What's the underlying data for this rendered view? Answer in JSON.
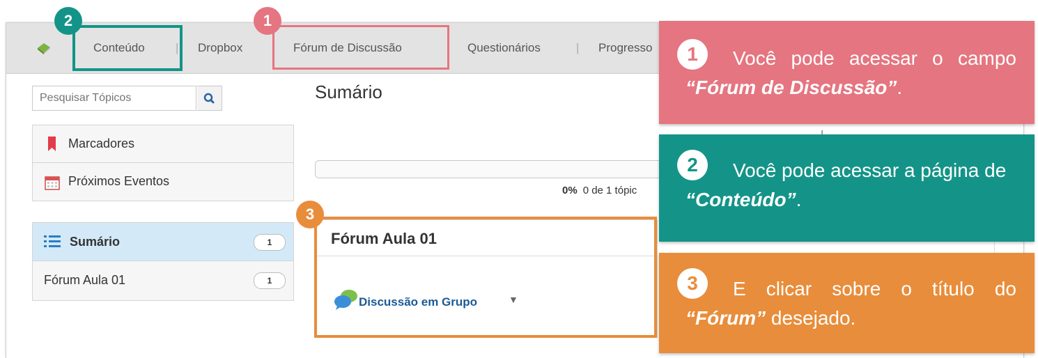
{
  "nav": {
    "items": [
      "Conteúdo",
      "Dropbox",
      "Fórum de Discussão",
      "Questionários",
      "Progresso"
    ],
    "separator": "|"
  },
  "sidebar": {
    "search_placeholder": "Pesquisar Tópicos",
    "bookmarks_label": "Marcadores",
    "events_label": "Próximos Eventos",
    "toc": [
      {
        "label": "Sumário",
        "count": "1"
      },
      {
        "label": "Fórum Aula 01",
        "count": "1"
      }
    ]
  },
  "main": {
    "title": "Sumário",
    "progress": {
      "percent_label": "0%",
      "detail": "0 de 1 tópic",
      "fraction": 0
    },
    "forum": {
      "title": "Fórum Aula 01",
      "topic": "Discussão em Grupo"
    }
  },
  "annotations": [
    {
      "number": "1",
      "color": "#e57580",
      "text_before": "Você pode acessar o campo",
      "emphasis": "“Fórum de Discussão”",
      "text_after": "."
    },
    {
      "number": "2",
      "color": "#149488",
      "text_before": "Você pode acessar a página de",
      "emphasis": "“Conteúdo”",
      "text_after": "."
    },
    {
      "number": "3",
      "color": "#e88d3b",
      "text_before": "E clicar sobre o título do",
      "emphasis": "“Fórum”",
      "text_after": "desejado."
    }
  ]
}
